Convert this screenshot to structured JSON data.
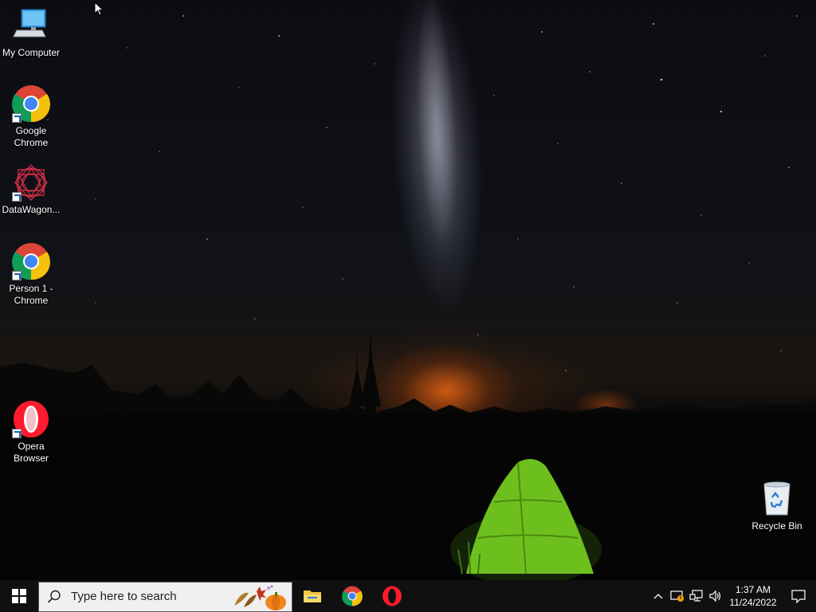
{
  "desktop": {
    "icons": [
      {
        "id": "my-computer",
        "label": "My Computer"
      },
      {
        "id": "google-chrome",
        "label": "Google Chrome"
      },
      {
        "id": "datawagon",
        "label": "DataWagon..."
      },
      {
        "id": "person1-chrome",
        "label": "Person 1 - Chrome"
      },
      {
        "id": "opera",
        "label": "Opera Browser"
      },
      {
        "id": "recycle-bin",
        "label": "Recycle Bin"
      }
    ]
  },
  "taskbar": {
    "search_placeholder": "Type here to search",
    "pinned_apps": [
      "file-explorer",
      "google-chrome",
      "opera"
    ],
    "clock": {
      "time": "1:37 AM",
      "date": "11/24/2022"
    }
  },
  "colors": {
    "taskbar_bg": "#101010",
    "search_bg": "#f0f0f0",
    "tent_green": "#7ed321",
    "chrome_red": "#db4437",
    "chrome_yellow": "#f4c20d",
    "chrome_green": "#0f9d58",
    "chrome_blue": "#4285f4",
    "opera_red": "#ff1b2d"
  }
}
